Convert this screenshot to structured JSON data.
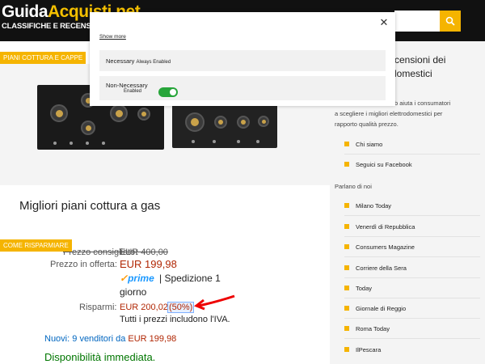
{
  "header": {
    "logo_part1": "Guida",
    "logo_part2": "Acquisti.net",
    "tagline": "CLASSIFICHE E RECENSIONI MIGLIORI",
    "search_placeholder": ""
  },
  "tags": {
    "category": "PIANI COTTURA E CAPPE",
    "savings": "COME RISPARMIARE"
  },
  "article": {
    "title": "Migliori piani cottura a gas"
  },
  "price_box": {
    "suggested_label": "Prezzo consigliato:",
    "suggested_value": "EUR 400,00",
    "offer_label": "Prezzo in offerta:",
    "offer_value": "EUR 199,98",
    "prime": "prime",
    "shipping": "| Spedizione 1",
    "shipping2": "giorno",
    "savings_label": "Risparmi:",
    "savings_value": "EUR 200,02",
    "savings_pct": "(50%)",
    "vat": "Tutti i prezzi includono l'IVA.",
    "new_label": "Nuovi:",
    "new_count": "9",
    "new_text": "venditori da",
    "new_price": "EUR 199,98",
    "availability": "Disponibilità immediata."
  },
  "sidebar": {
    "heading_line1": "censioni dei",
    "heading_line2": "lomestici",
    "intro1": "b aiuta i consumatori",
    "intro2": "a scegliere i migliori elettrodomestici per",
    "intro3": "rapporto qualità prezzo.",
    "links": [
      {
        "label": "Chi siamo"
      },
      {
        "label": "Seguici su Facebook"
      }
    ],
    "press_heading": "Parlano di noi",
    "press": [
      {
        "label": "Milano Today"
      },
      {
        "label": "Venerdì di Repubblica"
      },
      {
        "label": "Consumers Magazine"
      },
      {
        "label": "Corriere della Sera"
      },
      {
        "label": "Today"
      },
      {
        "label": "Giornale di Reggio"
      },
      {
        "label": "Roma Today"
      },
      {
        "label": "IlPescara"
      }
    ]
  },
  "cookie": {
    "close": "✕",
    "show_more": "Show more",
    "necessary_label": "Necessary",
    "necessary_state": "Always Enabled",
    "nonnecessary_label": "Non-Necessary",
    "nonnecessary_state": "Enabled"
  },
  "colors": {
    "accent": "#f5b400",
    "toggle_on": "#27a53a",
    "price_red": "#b12704"
  }
}
